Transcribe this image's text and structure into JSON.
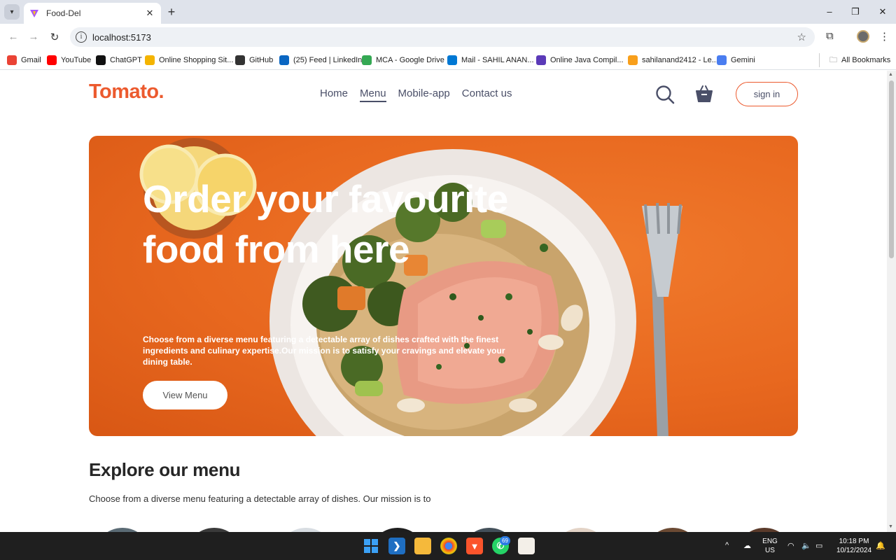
{
  "browser": {
    "tab_title": "Food-Del",
    "url": "localhost:5173",
    "bookmarks": [
      {
        "label": "Gmail",
        "color": "#ea4335"
      },
      {
        "label": "YouTube",
        "color": "#ff0000"
      },
      {
        "label": "ChatGPT",
        "color": "#111111"
      },
      {
        "label": "Online Shopping Sit...",
        "color": "#f4b400"
      },
      {
        "label": "GitHub",
        "color": "#333333"
      },
      {
        "label": "(25) Feed | LinkedIn",
        "color": "#0a66c2"
      },
      {
        "label": "MCA - Google Drive",
        "color": "#34a853"
      },
      {
        "label": "Mail - SAHIL ANAN...",
        "color": "#0078d4"
      },
      {
        "label": "Online Java Compil...",
        "color": "#5b3ab8"
      },
      {
        "label": "sahilanand2412 - Le...",
        "color": "#f89f1b"
      },
      {
        "label": "Gemini",
        "color": "#4a7df0"
      }
    ],
    "all_bookmarks": "All Bookmarks"
  },
  "page": {
    "logo": "Tomato.",
    "nav": [
      "Home",
      "Menu",
      "Mobile-app",
      "Contact us"
    ],
    "active_nav": "Menu",
    "sign_in": "sign in",
    "hero": {
      "title": "Order your favourite food from here",
      "description": "Choose from a diverse menu featuring a detectable array of dishes crafted with the finest ingredients and culinary expertise.Our mission is to satisfy your cravings and elevate your dining table.",
      "button": "View Menu"
    },
    "explore": {
      "title": "Explore our menu",
      "text": "Choose from a diverse menu featuring a detectable array of dishes. Our mission is to"
    }
  },
  "colors": {
    "brand": "#ec5a2e",
    "nav_text": "#4a4f68",
    "hero_bg": "#e8681f"
  },
  "taskbar": {
    "whatsapp_badge": "69",
    "lang_line1": "ENG",
    "lang_line2": "US",
    "time": "10:18 PM",
    "date": "10/12/2024"
  }
}
